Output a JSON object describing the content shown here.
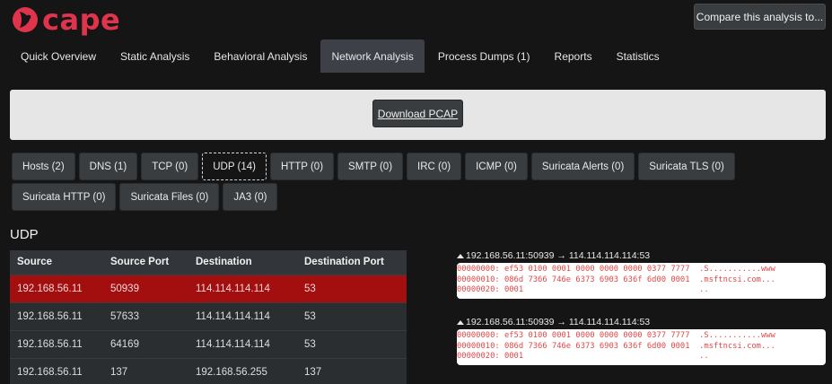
{
  "brand": {
    "logo_text": "cape",
    "color": "#e0344d"
  },
  "header": {
    "compare_label": "Compare this analysis to..."
  },
  "main_tabs": [
    {
      "label": "Quick Overview",
      "active": false
    },
    {
      "label": "Static Analysis",
      "active": false
    },
    {
      "label": "Behavioral Analysis",
      "active": false
    },
    {
      "label": "Network Analysis",
      "active": true
    },
    {
      "label": "Process Dumps (1)",
      "active": false
    },
    {
      "label": "Reports",
      "active": false
    },
    {
      "label": "Statistics",
      "active": false
    }
  ],
  "download": {
    "label": "Download PCAP"
  },
  "sub_tabs": [
    {
      "label": "Hosts (2)",
      "active": false
    },
    {
      "label": "DNS (1)",
      "active": false
    },
    {
      "label": "TCP (0)",
      "active": false
    },
    {
      "label": "UDP (14)",
      "active": true
    },
    {
      "label": "HTTP (0)",
      "active": false
    },
    {
      "label": "SMTP (0)",
      "active": false
    },
    {
      "label": "IRC (0)",
      "active": false
    },
    {
      "label": "ICMP (0)",
      "active": false
    },
    {
      "label": "Suricata Alerts (0)",
      "active": false
    },
    {
      "label": "Suricata TLS (0)",
      "active": false
    },
    {
      "label": "Suricata HTTP (0)",
      "active": false
    },
    {
      "label": "Suricata Files (0)",
      "active": false
    },
    {
      "label": "JA3 (0)",
      "active": false
    }
  ],
  "section": {
    "title": "UDP"
  },
  "table": {
    "columns": [
      "Source",
      "Source Port",
      "Destination",
      "Destination Port"
    ],
    "rows": [
      [
        "192.168.56.11",
        "50939",
        "114.114.114.114",
        "53"
      ],
      [
        "192.168.56.11",
        "57633",
        "114.114.114.114",
        "53"
      ],
      [
        "192.168.56.11",
        "64169",
        "114.114.114.114",
        "53"
      ],
      [
        "192.168.56.11",
        "137",
        "192.168.56.255",
        "137"
      ]
    ],
    "selected_row": 0
  },
  "hex_blocks": [
    {
      "header": "192.168.56.11:50939 → 114.114.114.114:53",
      "lines": [
        "00000000: ef53 0100 0001 0000 0000 0000 0377 7777  .S...........www",
        "00000010: 086d 7366 746e 6373 6903 636f 6d00 0001  .msftncsi.com...",
        "00000020: 0001                                     .."
      ]
    },
    {
      "header": "192.168.56.11:50939 → 114.114.114.114:53",
      "lines": [
        "00000000: ef53 0100 0001 0000 0000 0000 0377 7777  .S...........www",
        "00000010: 086d 7366 746e 6373 6903 636f 6d00 0001  .msftncsi.com...",
        "00000020: 0001                                     .."
      ]
    }
  ]
}
